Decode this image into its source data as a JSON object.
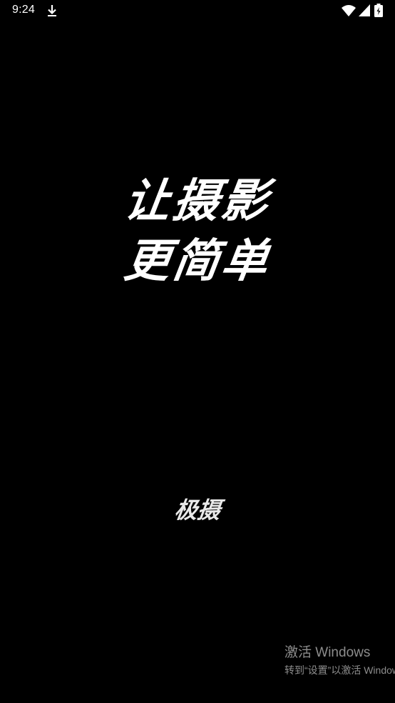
{
  "status_bar": {
    "time": "9:24",
    "icons": [
      "download-icon",
      "wifi-icon",
      "cellular-signal-icon",
      "battery-icon"
    ]
  },
  "splash": {
    "slogan_line_1": "让摄影",
    "slogan_line_2": "更简单",
    "brand_name": "极摄"
  },
  "watermark": {
    "title": "激活 Windows",
    "subtitle": "转到“设置”以激活 Windows。"
  },
  "colors": {
    "background": "#000000",
    "text": "#ffffff",
    "watermark": "#8d8d8d"
  }
}
